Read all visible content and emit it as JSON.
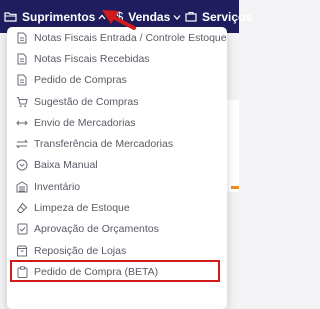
{
  "nav": {
    "suprimentos": "Suprimentos",
    "vendas": "Vendas",
    "servicos": "Serviços"
  },
  "menu": {
    "items": [
      {
        "label": "Notas Fiscais Entrada / Controle Estoque",
        "icon": "document-icon"
      },
      {
        "label": "Notas Fiscais Recebidas",
        "icon": "document-icon"
      },
      {
        "label": "Pedido de Compras",
        "icon": "document-icon"
      },
      {
        "label": "Sugestão de Compras",
        "icon": "shopping-cart-icon"
      },
      {
        "label": "Envio de Mercadorias",
        "icon": "arrows-horizontal-icon"
      },
      {
        "label": "Transferência de Mercadorias",
        "icon": "transfer-arrows-icon"
      },
      {
        "label": "Baixa Manual",
        "icon": "chevron-circle-icon"
      },
      {
        "label": "Inventário",
        "icon": "warehouse-icon"
      },
      {
        "label": "Limpeza de Estoque",
        "icon": "eraser-icon"
      },
      {
        "label": "Aprovação de Orçamentos",
        "icon": "check-document-icon"
      },
      {
        "label": "Reposição de Lojas",
        "icon": "box-icon"
      },
      {
        "label": "Pedido de Compra (BETA)",
        "icon": "clipboard-icon"
      }
    ]
  },
  "colors": {
    "topbar": "#1f1d5e",
    "highlight": "#d11a1a",
    "accent": "#f28c1e"
  }
}
